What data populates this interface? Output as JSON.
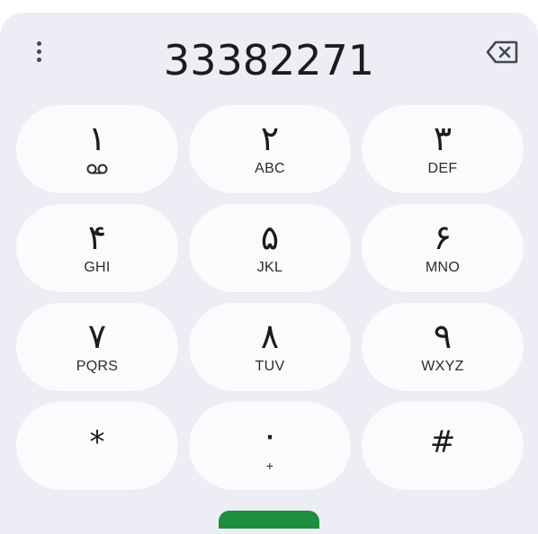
{
  "dialer": {
    "number": "33382271",
    "menu_icon": "more-vert-icon",
    "backspace_icon": "backspace-icon"
  },
  "keys": [
    {
      "digit": "۱",
      "letters": "",
      "icon": "voicemail-icon"
    },
    {
      "digit": "۲",
      "letters": "ABC"
    },
    {
      "digit": "۳",
      "letters": "DEF"
    },
    {
      "digit": "۴",
      "letters": "GHI"
    },
    {
      "digit": "۵",
      "letters": "JKL"
    },
    {
      "digit": "۶",
      "letters": "MNO"
    },
    {
      "digit": "۷",
      "letters": "PQRS"
    },
    {
      "digit": "۸",
      "letters": "TUV"
    },
    {
      "digit": "۹",
      "letters": "WXYZ"
    },
    {
      "digit": "*",
      "letters": ""
    },
    {
      "digit": "۰",
      "letters": "+"
    },
    {
      "digit": "#",
      "letters": ""
    }
  ],
  "colors": {
    "panel_bg": "#edeef5",
    "key_bg": "#fbfbfd",
    "text": "#1b1c20",
    "call_button": "#1e8e3e"
  }
}
